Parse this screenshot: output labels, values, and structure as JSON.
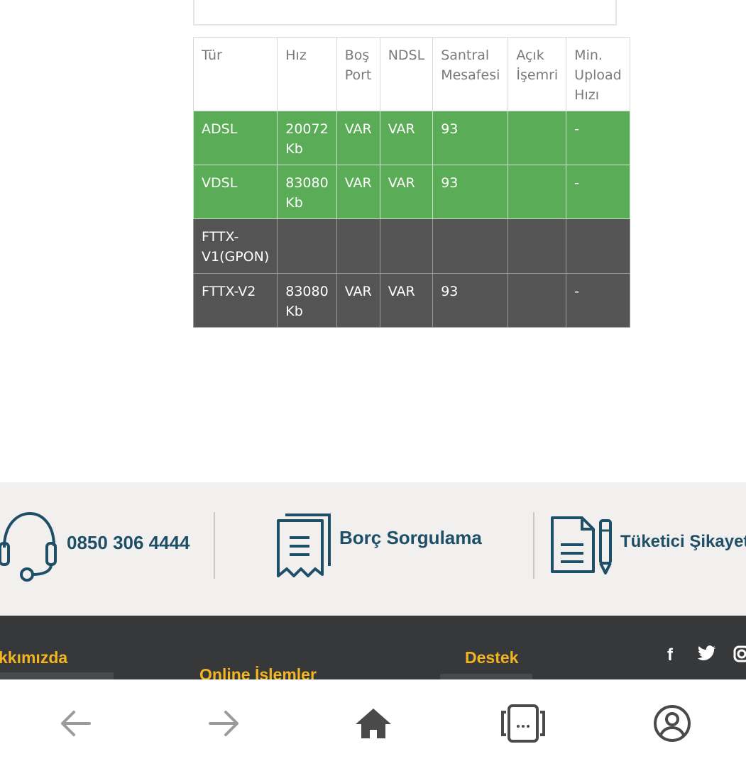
{
  "table": {
    "headers": [
      "Tür",
      "Hız",
      "Boş Port",
      "NDSL",
      "Santral Mesafesi",
      "Açık İşemri",
      "Min. Upload Hızı"
    ],
    "rows": [
      {
        "status": "green",
        "cells": [
          "ADSL",
          "20072 Kb",
          "VAR",
          "VAR",
          "93",
          "",
          "-"
        ]
      },
      {
        "status": "green",
        "cells": [
          "VDSL",
          "83080 Kb",
          "VAR",
          "VAR",
          "93",
          "",
          "-"
        ]
      },
      {
        "status": "dark",
        "cells": [
          "FTTX-V1(GPON)",
          "",
          "",
          "",
          "",
          "",
          ""
        ]
      },
      {
        "status": "dark",
        "cells": [
          "FTTX-V2",
          "83080 Kb",
          "VAR",
          "VAR",
          "93",
          "",
          "-"
        ]
      }
    ]
  },
  "quick_actions": {
    "phone": {
      "label": "0850 306 4444",
      "icon": "headset-icon"
    },
    "debt": {
      "label": "Borç Sorgulama",
      "icon": "receipt-icon"
    },
    "complaint": {
      "label": "Tüketici Şikayetle",
      "icon": "document-pen-icon"
    }
  },
  "footer": {
    "about": "kkımızda",
    "online": "Online İşlemler",
    "support": "Destek",
    "social_icons": [
      "facebook-icon",
      "twitter-icon",
      "instagram-icon"
    ]
  },
  "colors": {
    "green": "#5aac57",
    "dark": "#545454",
    "accent": "#f2b522",
    "brand": "#1f4f66"
  },
  "bottom_nav": [
    "back-arrow-icon",
    "forward-arrow-icon",
    "home-icon",
    "tabs-icon",
    "account-icon"
  ]
}
